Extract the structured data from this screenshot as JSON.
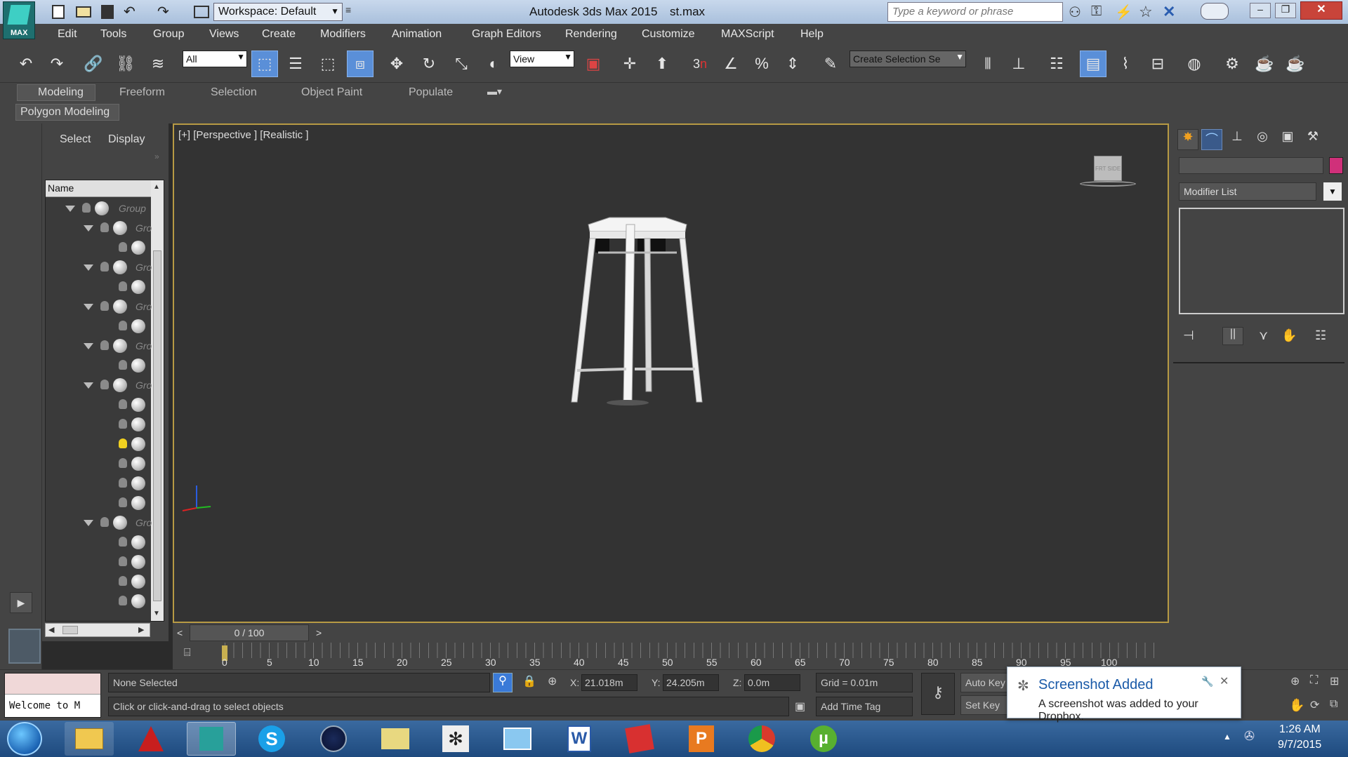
{
  "titlebar": {
    "workspace": "Workspace: Default",
    "app_title": "Autodesk 3ds Max  2015",
    "file_name": "st.max",
    "search_placeholder": "Type a keyword or phrase",
    "logo_text": "MAX"
  },
  "menu": [
    "Edit",
    "Tools",
    "Group",
    "Views",
    "Create",
    "Modifiers",
    "Animation",
    "Graph Editors",
    "Rendering",
    "Customize",
    "MAXScript",
    "Help"
  ],
  "toolbar": {
    "selection_filter": "All",
    "reference_coord": "View",
    "named_selection_placeholder": "Create Selection Se"
  },
  "ribbon": {
    "tabs": [
      "Modeling",
      "Freeform",
      "Selection",
      "Object Paint",
      "Populate"
    ],
    "active_tab": "Modeling",
    "subtab": "Polygon Modeling"
  },
  "scene_explorer": {
    "tabs": [
      "Select",
      "Display"
    ],
    "column_header": "Name",
    "root_label": "Group",
    "group_label": "Gro"
  },
  "viewport": {
    "label": "[+] [Perspective ] [Realistic ]",
    "viewcube_text": "FRT  SIDE"
  },
  "command_panel": {
    "modifier_list": "Modifier List",
    "color_swatch": "#d0307a"
  },
  "timeline": {
    "frame_counter": "0 / 100",
    "ticks": [
      "0",
      "5",
      "10",
      "15",
      "20",
      "25",
      "30",
      "35",
      "40",
      "45",
      "50",
      "55",
      "60",
      "65",
      "70",
      "75",
      "80",
      "85",
      "90",
      "95",
      "100"
    ]
  },
  "status": {
    "listener_text": "Welcome to M",
    "selection": "None Selected",
    "prompt": "Click or click-and-drag to select objects",
    "x_label": "X:",
    "x_value": "21.018m",
    "y_label": "Y:",
    "y_value": "24.205m",
    "z_label": "Z:",
    "z_value": "0.0m",
    "grid": "Grid = 0.01m",
    "add_time_tag": "Add Time Tag",
    "auto_key": "Auto Key",
    "set_key": "Set Key"
  },
  "notification": {
    "title": "Screenshot Added",
    "body": "A screenshot was added to your Dropbox."
  },
  "taskbar": {
    "time": "1:26 AM",
    "date": "9/7/2015"
  }
}
